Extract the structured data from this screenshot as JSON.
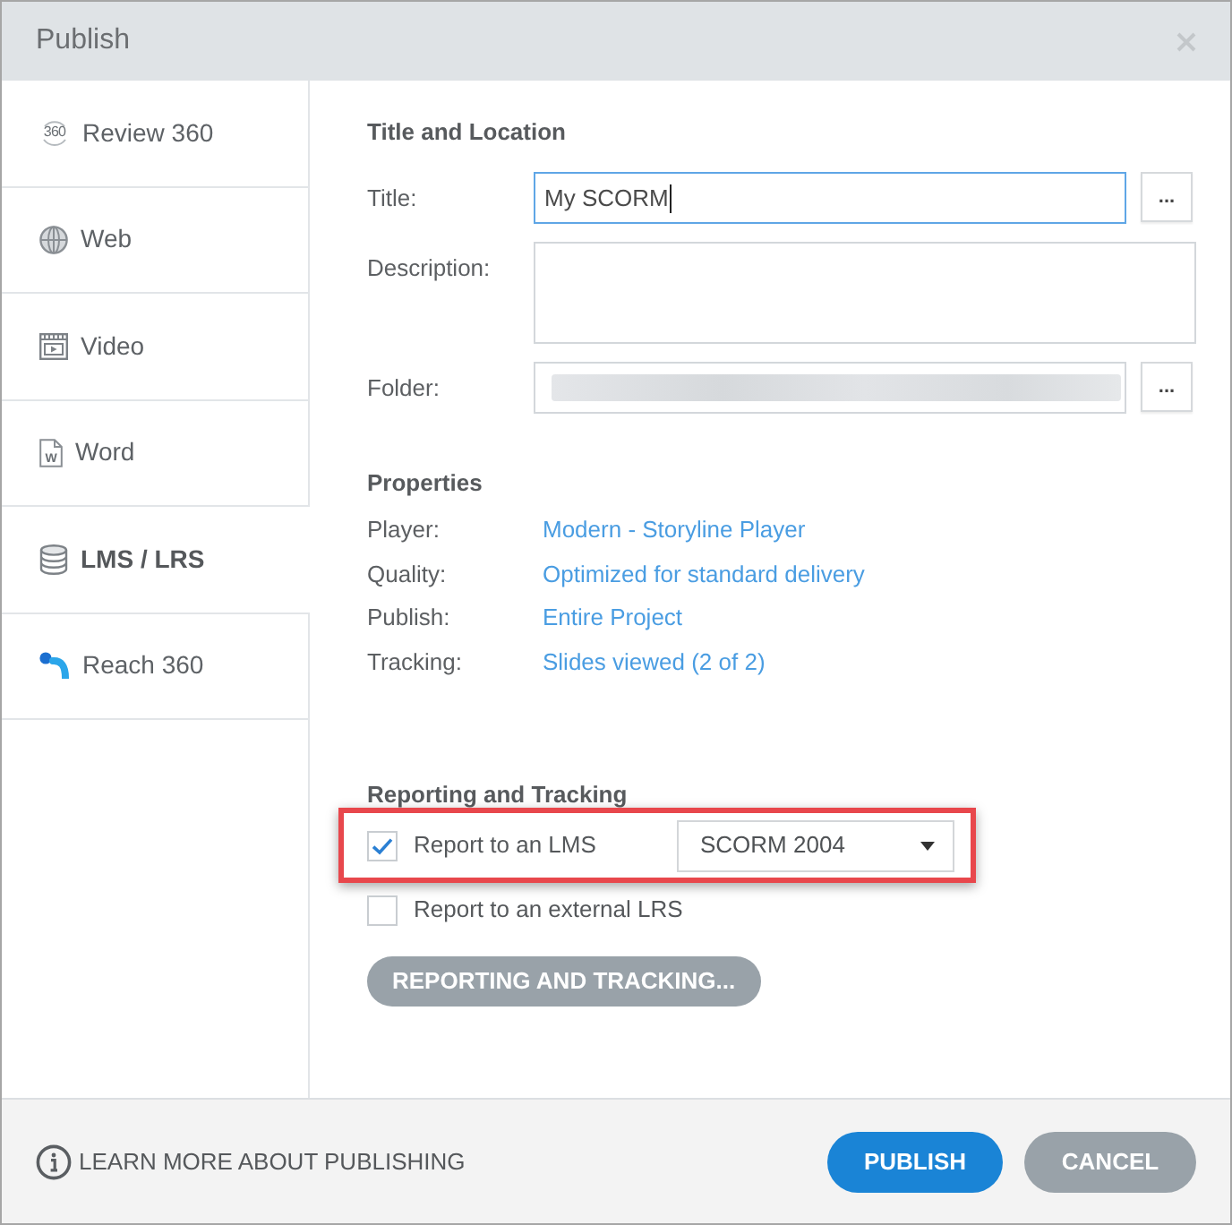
{
  "window": {
    "title": "Publish"
  },
  "sidebar": {
    "items": [
      {
        "label": "Review 360",
        "kind": "review",
        "icon_text": "360",
        "selected": false
      },
      {
        "label": "Web",
        "kind": "web",
        "selected": false
      },
      {
        "label": "Video",
        "kind": "video",
        "selected": false
      },
      {
        "label": "Word",
        "kind": "word",
        "icon_text": "W",
        "selected": false
      },
      {
        "label": "LMS / LRS",
        "kind": "lms",
        "selected": true
      },
      {
        "label": "Reach 360",
        "kind": "reach",
        "selected": false
      }
    ]
  },
  "title_and_location": {
    "heading": "Title and Location",
    "fields": [
      {
        "label": "Title:",
        "kind": "input",
        "value": "My SCORM",
        "focused": true,
        "redacted": false,
        "browse": "..."
      },
      {
        "label": "Description:",
        "kind": "textarea",
        "focused": false,
        "redacted": false
      },
      {
        "label": "Folder:",
        "kind": "input",
        "focused": false,
        "redacted": true,
        "browse": "..."
      }
    ]
  },
  "properties": {
    "heading": "Properties",
    "rows": [
      {
        "label": "Player:",
        "value": "Modern - Storyline Player"
      },
      {
        "label": "Quality:",
        "value": "Optimized for standard delivery"
      },
      {
        "label": "Publish:",
        "value": "Entire Project"
      },
      {
        "label": "Tracking:",
        "value": "Slides viewed (2 of 2)"
      }
    ]
  },
  "reporting": {
    "heading": "Reporting and Tracking",
    "options": [
      {
        "label": "Report to an LMS",
        "checked": true,
        "highlighted": true,
        "dropdown": "SCORM 2004"
      },
      {
        "label": "Report to an external LRS",
        "checked": false,
        "highlighted": false
      }
    ],
    "button": "REPORTING AND TRACKING..."
  },
  "footer": {
    "link": "LEARN MORE ABOUT PUBLISHING",
    "buttons": [
      {
        "label": "PUBLISH",
        "kind": "primary"
      },
      {
        "label": "CANCEL",
        "kind": "secondary"
      }
    ]
  }
}
